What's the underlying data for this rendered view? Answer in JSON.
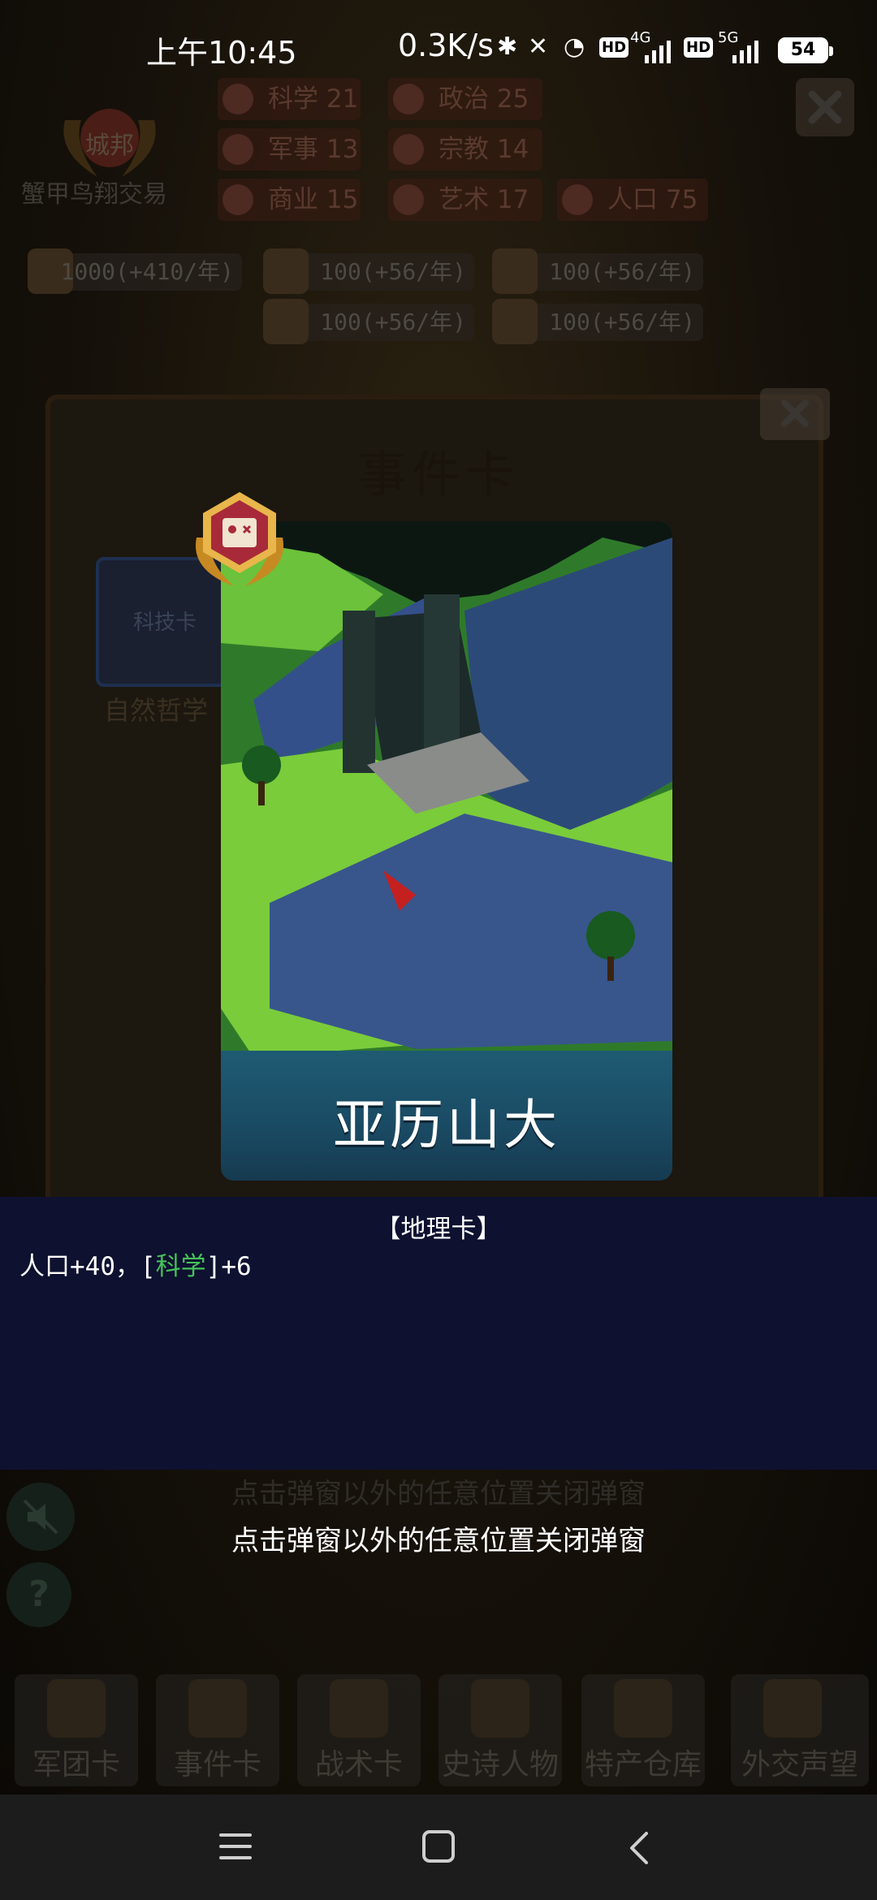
{
  "status_bar": {
    "time": "上午10:45",
    "speed": "0.3K/s",
    "battery": "54",
    "network_1": "4G",
    "network_2": "5G",
    "hd_label": "HD"
  },
  "background": {
    "polity_badge": "城邦",
    "polity_name": "蟹甲鸟翔交易",
    "stats": [
      {
        "label": "科学",
        "value": "21",
        "icon": "science-icon"
      },
      {
        "label": "政治",
        "value": "25",
        "icon": "politics-icon"
      },
      {
        "label": "军事",
        "value": "13",
        "icon": "military-icon"
      },
      {
        "label": "宗教",
        "value": "14",
        "icon": "religion-icon"
      },
      {
        "label": "商业",
        "value": "15",
        "icon": "commerce-icon"
      },
      {
        "label": "艺术",
        "value": "17",
        "icon": "art-icon"
      },
      {
        "label": "人口",
        "value": "75",
        "icon": "population-icon"
      }
    ],
    "resources": [
      "1000(+410/年)",
      "100(+56/年)",
      "100(+56/年)",
      "100(+56/年)",
      "100(+56/年)"
    ],
    "panel_title": "事件卡",
    "tech_card_label": "科技卡",
    "tech_card_name": "自然哲学",
    "hint_ghost": "点击弹窗以外的任意位置关闭弹窗",
    "bottom_tabs": [
      "军团卡",
      "事件卡",
      "战术卡",
      "史诗人物",
      "特产仓库",
      "外交声望"
    ]
  },
  "card": {
    "title": "亚历山大",
    "category": "【地理卡】",
    "effect_prefix": "人口+40，[",
    "effect_highlight": "科学",
    "effect_suffix": "]+6",
    "badge_icon": "map-icon"
  },
  "hint": "点击弹窗以外的任意位置关闭弹窗",
  "colors": {
    "panel_bg": "#0e1130",
    "highlight_green": "#45c25a",
    "banner_blue": "#1e5b73"
  }
}
